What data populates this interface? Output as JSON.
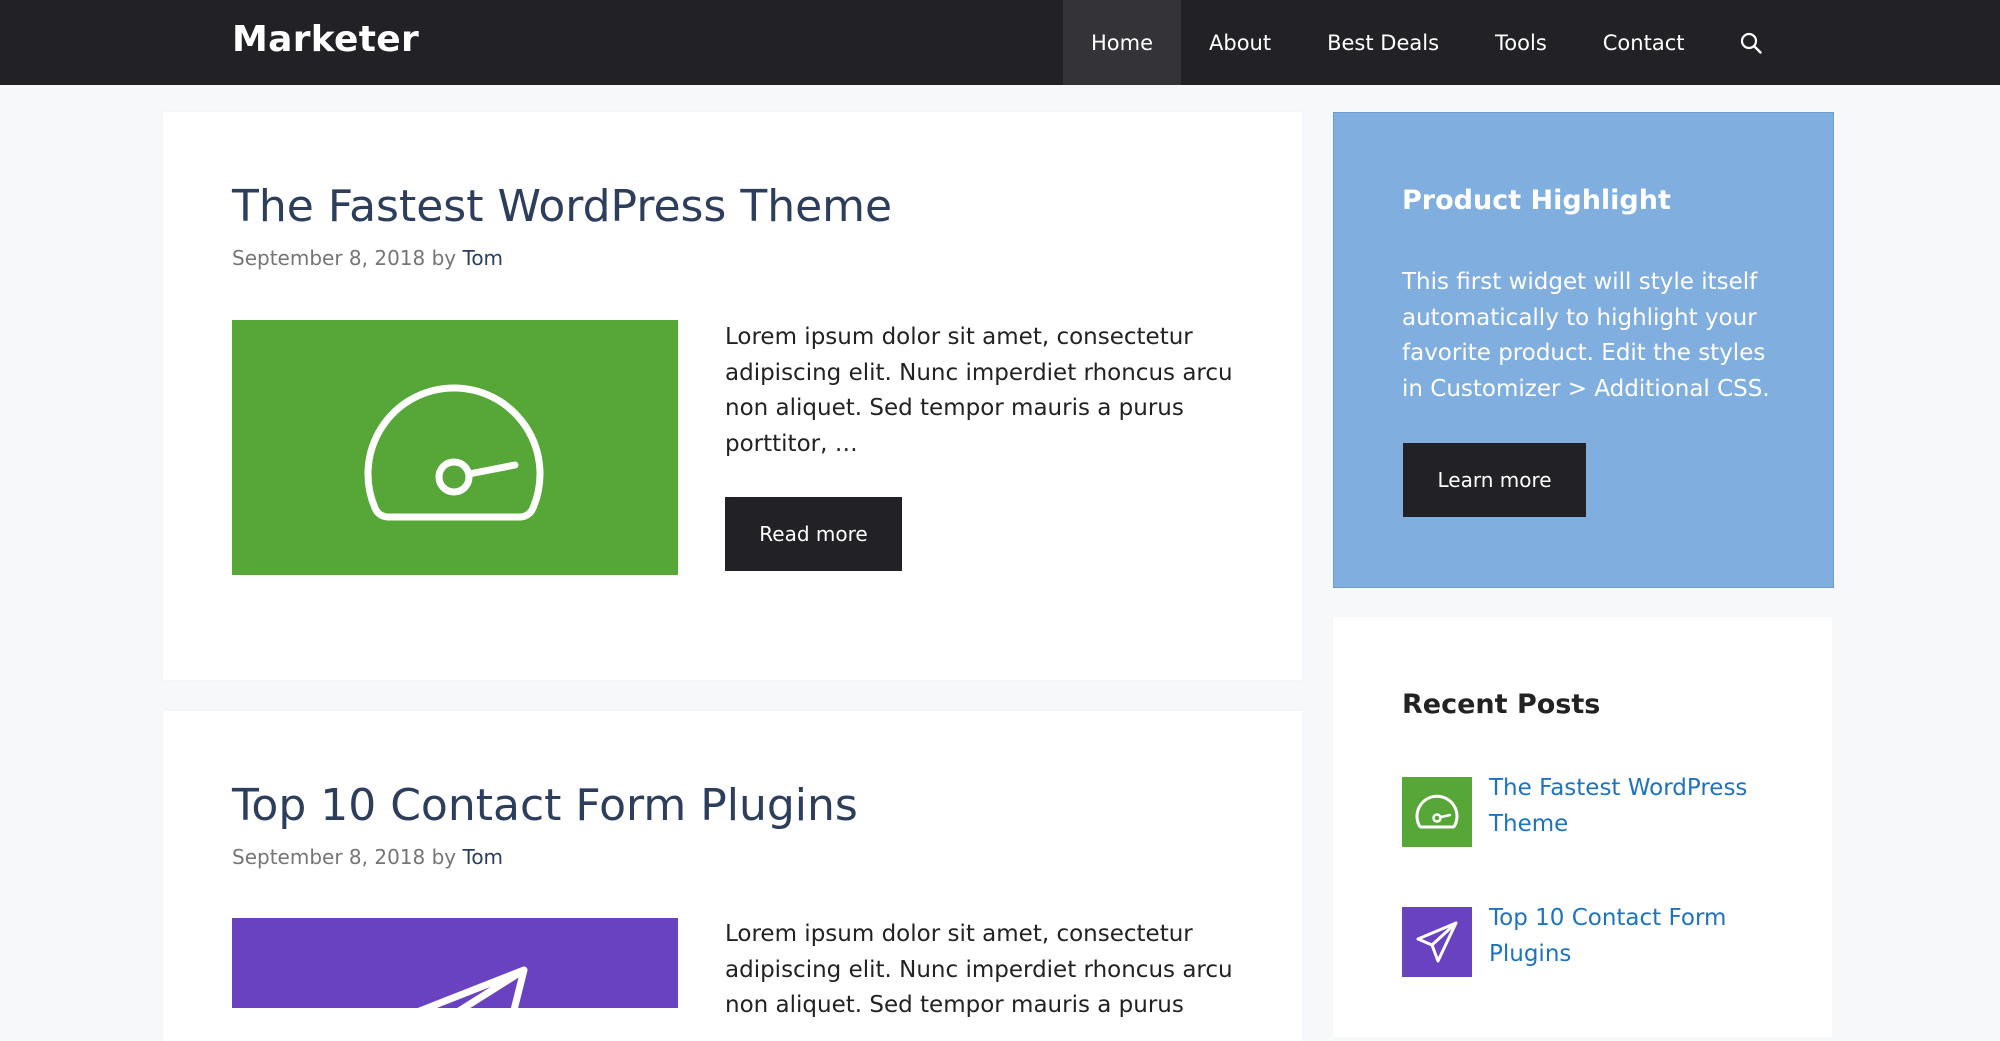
{
  "site": {
    "title": "Marketer"
  },
  "nav": {
    "items": [
      {
        "label": "Home",
        "active": true
      },
      {
        "label": "About"
      },
      {
        "label": "Best Deals"
      },
      {
        "label": "Tools"
      },
      {
        "label": "Contact"
      }
    ],
    "search_icon": "search-icon"
  },
  "posts": [
    {
      "title": "The Fastest WordPress Theme",
      "date": "September 8, 2018",
      "by": "by",
      "author": "Tom",
      "excerpt": "Lorem ipsum dolor sit amet, consectetur adipiscing elit. Nunc imperdiet rhoncus arcu non aliquet. Sed tempor mauris a purus porttitor, …",
      "read_more": "Read more",
      "thumb_color": "#57a638",
      "thumb_icon": "speedometer-icon"
    },
    {
      "title": "Top 10 Contact Form Plugins",
      "date": "September 8, 2018",
      "by": "by",
      "author": "Tom",
      "excerpt": "Lorem ipsum dolor sit amet, consectetur adipiscing elit. Nunc imperdiet rhoncus arcu non aliquet. Sed tempor mauris a purus",
      "thumb_color": "#6842c0",
      "thumb_icon": "paper-plane-icon"
    }
  ],
  "sidebar": {
    "highlight": {
      "title": "Product Highlight",
      "text": "This first widget will style itself automatically to highlight your favorite product. Edit the styles in Customizer > Additional CSS.",
      "button": "Learn more",
      "bg_color": "#80aedf"
    },
    "recent": {
      "title": "Recent Posts",
      "items": [
        {
          "label": "The Fastest WordPress Theme",
          "thumb_color": "#57a638",
          "icon": "speedometer-icon"
        },
        {
          "label": "Top 10 Contact Form Plugins",
          "thumb_color": "#6842c0",
          "icon": "paper-plane-icon"
        }
      ]
    }
  },
  "colors": {
    "header_bg": "#222226",
    "title_color": "#2d3d5c",
    "link_color": "#1e73be",
    "button_bg": "#222226"
  }
}
